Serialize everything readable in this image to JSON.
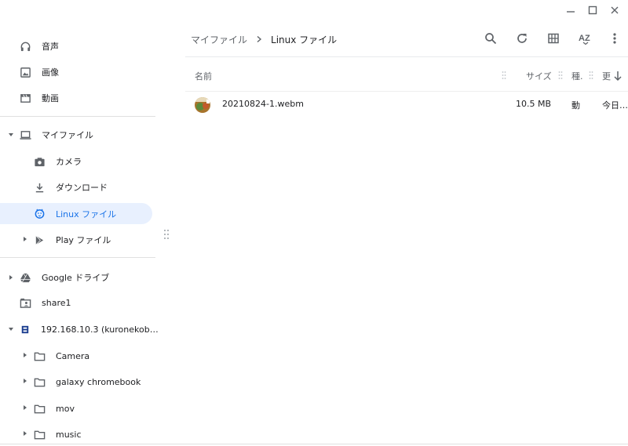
{
  "window": {
    "controls": [
      "minimize",
      "maximize",
      "close"
    ]
  },
  "sidebar": {
    "recent_items": [
      {
        "label": "音声",
        "icon": "headphones-icon"
      },
      {
        "label": "画像",
        "icon": "image-icon"
      },
      {
        "label": "動画",
        "icon": "video-icon"
      }
    ],
    "my_files": {
      "label": "マイファイル",
      "icon": "laptop-icon",
      "expanded": true
    },
    "my_files_children": [
      {
        "label": "カメラ",
        "icon": "camera-icon"
      },
      {
        "label": "ダウンロード",
        "icon": "download-icon"
      },
      {
        "label": "Linux ファイル",
        "icon": "penguin-icon",
        "selected": true
      },
      {
        "label": "Play ファイル",
        "icon": "play-icon"
      }
    ],
    "drives": [
      {
        "label": "Google ドライブ",
        "icon": "google-drive-icon"
      },
      {
        "label": "share1",
        "icon": "shared-folder-icon"
      },
      {
        "label": "192.168.10.3 (kuronekob…",
        "icon": "network-share-icon",
        "expanded": true
      }
    ],
    "share_children": [
      {
        "label": "Camera",
        "icon": "folder-icon"
      },
      {
        "label": "galaxy chromebook",
        "icon": "folder-icon"
      },
      {
        "label": "mov",
        "icon": "folder-icon"
      },
      {
        "label": "music",
        "icon": "folder-icon"
      }
    ]
  },
  "breadcrumb": {
    "parent": "マイファイル",
    "current": "Linux ファイル"
  },
  "toolbar": {
    "buttons": [
      "search-icon",
      "refresh-icon",
      "grid-view-icon",
      "sort-az-icon",
      "more-vert-icon"
    ],
    "sort_label": "AZ"
  },
  "file_list": {
    "columns": {
      "name": "名前",
      "size": "サイズ",
      "type": "種.",
      "date": "更"
    },
    "files": [
      {
        "name": "20210824-1.webm",
        "size": "10.5 MB",
        "type": "動",
        "date": "今日…"
      }
    ]
  },
  "colors": {
    "accent": "#1a73e8",
    "selected_bg": "#e8f0fe",
    "icon": "#5f6368"
  }
}
